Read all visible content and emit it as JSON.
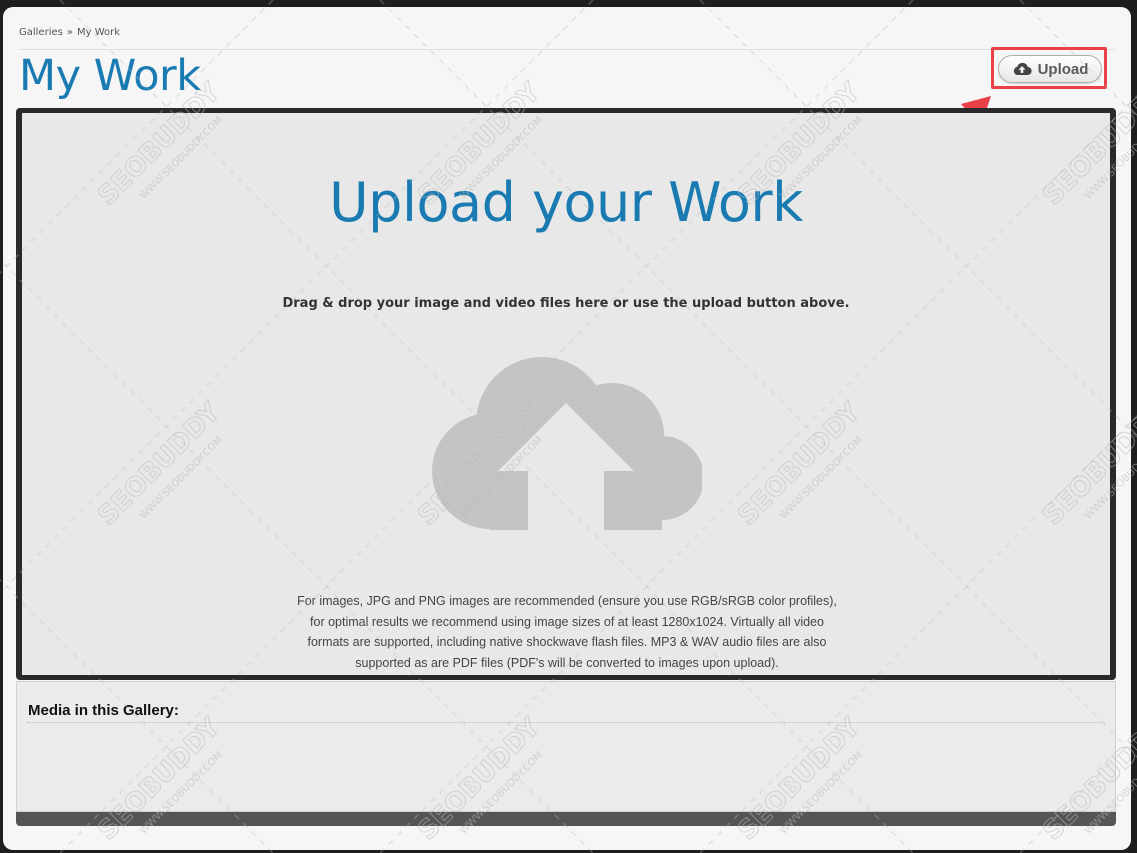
{
  "breadcrumb": {
    "items": [
      "Galleries",
      "My Work"
    ],
    "separator": "»"
  },
  "header": {
    "title": "My Work",
    "upload_label": "Upload"
  },
  "dropzone": {
    "heading": "Upload your Work",
    "instructions": "Drag & drop your image and video files here or use the upload button above.",
    "info_lines": [
      "For images, JPG and PNG images are recommended (ensure you use RGB/sRGB color profiles),",
      "for optimal results we recommend using image sizes of at least 1280x1024. Virtually all video",
      "formats are supported, including native shockwave flash files. MP3 & WAV audio files are also",
      "supported as are PDF files (PDF's will be converted to images upon upload)."
    ]
  },
  "gallery": {
    "title": "Media in this Gallery:"
  },
  "watermark": {
    "brand": "SEOBUDDY",
    "url": "WWW.SEOBUDDY.COM"
  },
  "colors": {
    "accent": "#1a7bb2",
    "highlight": "#e84147",
    "cloud": "#c4c4c4"
  },
  "icons": {
    "upload": "cloud-upload-icon",
    "arrow": "pointer-arrow-icon",
    "dropzone": "cloud-upload-icon"
  }
}
